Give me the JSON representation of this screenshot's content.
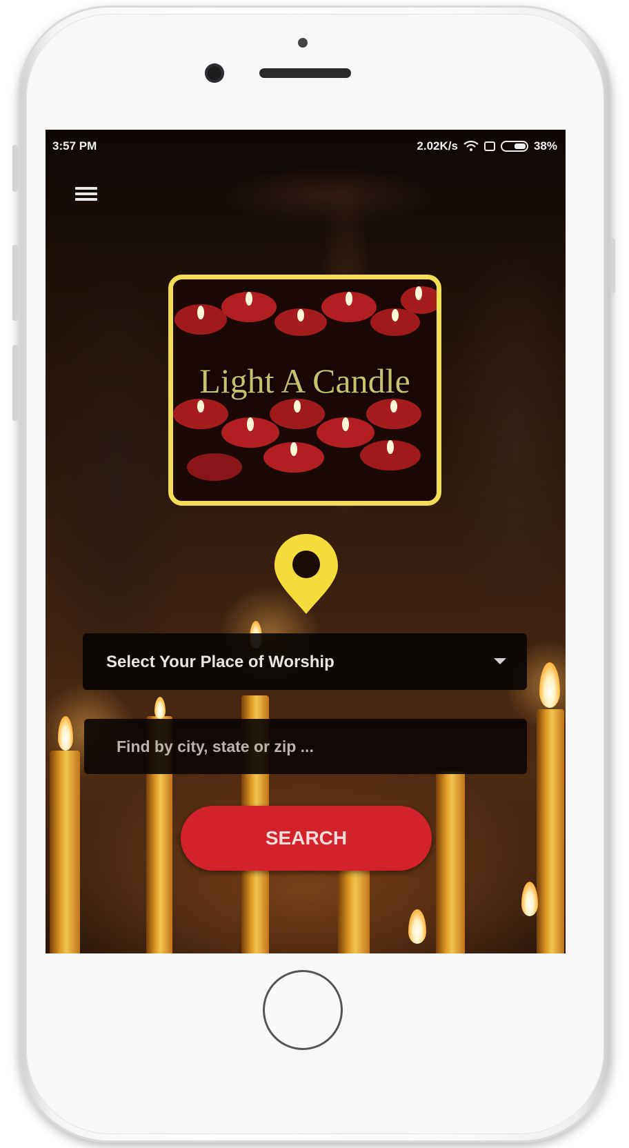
{
  "status_bar": {
    "time": "3:57 PM",
    "net_speed": "2.02K/s",
    "battery": "38%"
  },
  "logo": {
    "text": "Light A Candle"
  },
  "form": {
    "worship_select_label": "Select Your Place of Worship",
    "city_placeholder": "Find by city, state or zip ...",
    "city_value": "",
    "search_label": "SEARCH"
  },
  "colors": {
    "accent_red": "#d3222b",
    "logo_border": "#f1de56",
    "pin_yellow": "#f4dc3a"
  },
  "icons": [
    "menu-icon",
    "location-pin-icon",
    "chevron-down-icon",
    "wifi-icon",
    "sim-icon",
    "battery-icon"
  ]
}
